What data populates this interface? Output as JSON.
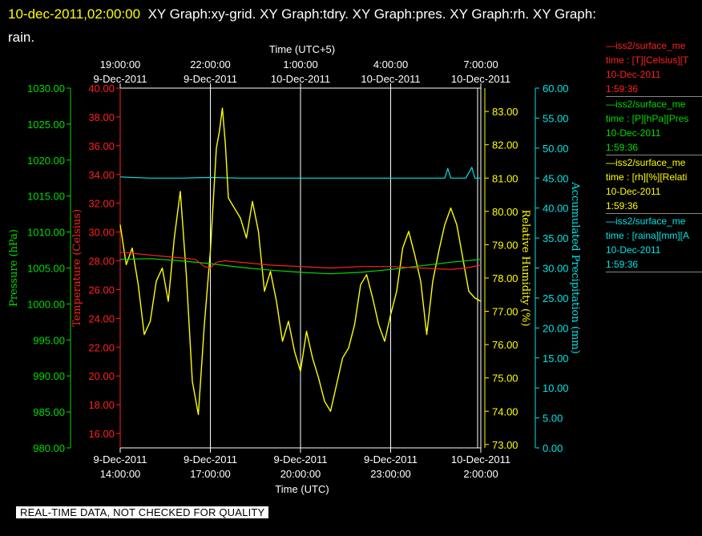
{
  "header": {
    "timestamp": "10-dec-2011,02:00:00",
    "graph_list": "XY Graph:xy-grid.  XY Graph:tdry.  XY Graph:pres.  XY Graph:rh.  XY Graph:",
    "graph_list_wrap": "rain."
  },
  "colors": {
    "background": "#000000",
    "temperature": "#ff2020",
    "pressure": "#00dd00",
    "humidity": "#ffff00",
    "precipitation": "#00e5e5",
    "grid": "#ffffff"
  },
  "legend": [
    {
      "name": "—iss2/surface_me",
      "line2": "time : [T][Celsius][T",
      "date": "10-Dec-2011",
      "time": "1:59:36",
      "color": "#ff2020"
    },
    {
      "name": "—iss2/surface_me",
      "line2": "time : [P][hPa][Pres",
      "date": "10-Dec-2011",
      "time": "1:59:36",
      "color": "#00dd00"
    },
    {
      "name": "—iss2/surface_me",
      "line2": "time : [rh][%][Relati",
      "date": "10-Dec-2011",
      "time": "1:59:36",
      "color": "#ffff00"
    },
    {
      "name": "—iss2/surface_me",
      "line2": "time : [raina][mm][A",
      "date": "10-Dec-2011",
      "time": "1:59:36",
      "color": "#00e5e5"
    }
  ],
  "disclaimer": "REAL-TIME DATA, NOT CHECKED FOR QUALITY",
  "chart_data": {
    "type": "line",
    "grid": true,
    "x_bottom": {
      "label": "Time (UTC)",
      "range_hours": [
        0,
        12
      ],
      "ticks": [
        {
          "hour": 0,
          "date": "9-Dec-2011",
          "time": "14:00:00"
        },
        {
          "hour": 3,
          "date": "9-Dec-2011",
          "time": "17:00:00"
        },
        {
          "hour": 6,
          "date": "9-Dec-2011",
          "time": "20:00:00"
        },
        {
          "hour": 9,
          "date": "9-Dec-2011",
          "time": "23:00:00"
        },
        {
          "hour": 12,
          "date": "10-Dec-2011",
          "time": "2:00:00"
        }
      ]
    },
    "x_top": {
      "label": "Time (UTC+5)",
      "ticks": [
        {
          "hour": 0,
          "time": "19:00:00",
          "date": "9-Dec-2011"
        },
        {
          "hour": 3,
          "time": "22:00:00",
          "date": "9-Dec-2011"
        },
        {
          "hour": 6,
          "time": "1:00:00",
          "date": "10-Dec-2011"
        },
        {
          "hour": 9,
          "time": "4:00:00",
          "date": "10-Dec-2011"
        },
        {
          "hour": 12,
          "time": "7:00:00",
          "date": "10-Dec-2011"
        }
      ]
    },
    "axes": {
      "pressure": {
        "label": "Pressure (hPa)",
        "range": [
          980,
          1030
        ],
        "ticks": [
          "980.00",
          "985.00",
          "990.00",
          "995.00",
          "1000.00",
          "1005.00",
          "1010.00",
          "1015.00",
          "1020.00",
          "1025.00",
          "1030.00"
        ]
      },
      "temperature": {
        "label": "Temperature (Celsius)",
        "range": [
          15,
          40
        ],
        "ticks": [
          "16.00",
          "18.00",
          "20.00",
          "22.00",
          "24.00",
          "26.00",
          "28.00",
          "30.00",
          "32.00",
          "34.00",
          "36.00",
          "38.00",
          "40.00"
        ]
      },
      "humidity": {
        "label": "Relative Humidity (%)",
        "range": [
          72.9,
          83.7
        ],
        "ticks": [
          "73.00",
          "74.00",
          "75.00",
          "76.00",
          "77.00",
          "78.00",
          "79.00",
          "80.00",
          "81.00",
          "82.00",
          "83.00"
        ]
      },
      "precipitation": {
        "label": "Accumulated Precipitation (mm)",
        "range": [
          0,
          60
        ],
        "ticks": [
          "0.00",
          "5.00",
          "10.00",
          "15.00",
          "20.00",
          "25.00",
          "30.00",
          "35.00",
          "40.00",
          "45.00",
          "50.00",
          "55.00",
          "60.00"
        ]
      }
    },
    "series": [
      {
        "name": "Temperature",
        "axis": "temperature",
        "x": [
          0,
          0.5,
          1,
          1.5,
          2,
          2.5,
          2.8,
          3,
          3.2,
          3.5,
          4,
          5,
          6,
          7,
          8,
          9,
          10,
          11,
          11.5,
          12
        ],
        "y": [
          28.6,
          28.5,
          28.4,
          28.3,
          28.2,
          28.1,
          27.6,
          27.5,
          27.9,
          28.0,
          27.9,
          27.7,
          27.6,
          27.5,
          27.6,
          27.6,
          27.5,
          27.4,
          27.5,
          27.7
        ]
      },
      {
        "name": "Pressure",
        "axis": "pressure",
        "x": [
          0,
          1,
          2,
          3,
          4,
          5,
          6,
          7,
          8,
          9,
          10,
          11,
          12
        ],
        "y": [
          1006.2,
          1006.3,
          1006.0,
          1005.6,
          1005.1,
          1004.7,
          1004.4,
          1004.2,
          1004.4,
          1004.8,
          1005.3,
          1005.8,
          1006.2
        ]
      },
      {
        "name": "Relative Humidity",
        "axis": "humidity",
        "x": [
          0,
          0.2,
          0.4,
          0.6,
          0.8,
          1.0,
          1.2,
          1.4,
          1.6,
          1.8,
          2.0,
          2.2,
          2.4,
          2.6,
          2.8,
          3.0,
          3.2,
          3.3,
          3.4,
          3.5,
          3.6,
          3.8,
          4.0,
          4.2,
          4.4,
          4.6,
          4.8,
          5.0,
          5.2,
          5.4,
          5.6,
          5.8,
          6.0,
          6.2,
          6.4,
          6.6,
          6.8,
          7.0,
          7.2,
          7.4,
          7.6,
          7.8,
          8.0,
          8.2,
          8.4,
          8.6,
          8.8,
          9.0,
          9.2,
          9.4,
          9.6,
          9.8,
          10.0,
          10.2,
          10.4,
          10.6,
          10.8,
          11.0,
          11.2,
          11.4,
          11.6,
          11.8,
          12.0
        ],
        "y": [
          79.6,
          78.4,
          78.9,
          77.8,
          76.3,
          76.7,
          77.9,
          78.3,
          77.3,
          79.2,
          80.6,
          78.1,
          74.9,
          73.9,
          76.6,
          78.8,
          81.9,
          82.4,
          83.1,
          82.0,
          80.4,
          80.1,
          79.8,
          79.2,
          80.3,
          79.4,
          77.6,
          78.2,
          77.3,
          76.1,
          76.7,
          75.8,
          75.2,
          76.4,
          75.6,
          75.0,
          74.3,
          74.0,
          74.8,
          75.6,
          75.9,
          76.6,
          77.8,
          78.1,
          77.4,
          76.6,
          76.1,
          76.9,
          77.6,
          78.9,
          79.4,
          78.7,
          77.9,
          76.3,
          77.9,
          78.8,
          79.6,
          80.1,
          79.6,
          78.6,
          77.6,
          77.4,
          77.3
        ]
      },
      {
        "name": "Accumulated Precipitation",
        "axis": "precipitation",
        "x": [
          0,
          1,
          2,
          3,
          4,
          5,
          6,
          7,
          8,
          9,
          10,
          10.8,
          10.9,
          11.0,
          11.5,
          11.7,
          11.8,
          12.0
        ],
        "y": [
          45.2,
          45.0,
          45.0,
          45.1,
          45.0,
          45.0,
          45.0,
          45.0,
          45.0,
          45.0,
          45.0,
          45.0,
          46.6,
          45.0,
          45.0,
          46.8,
          45.0,
          45.0
        ]
      }
    ]
  }
}
